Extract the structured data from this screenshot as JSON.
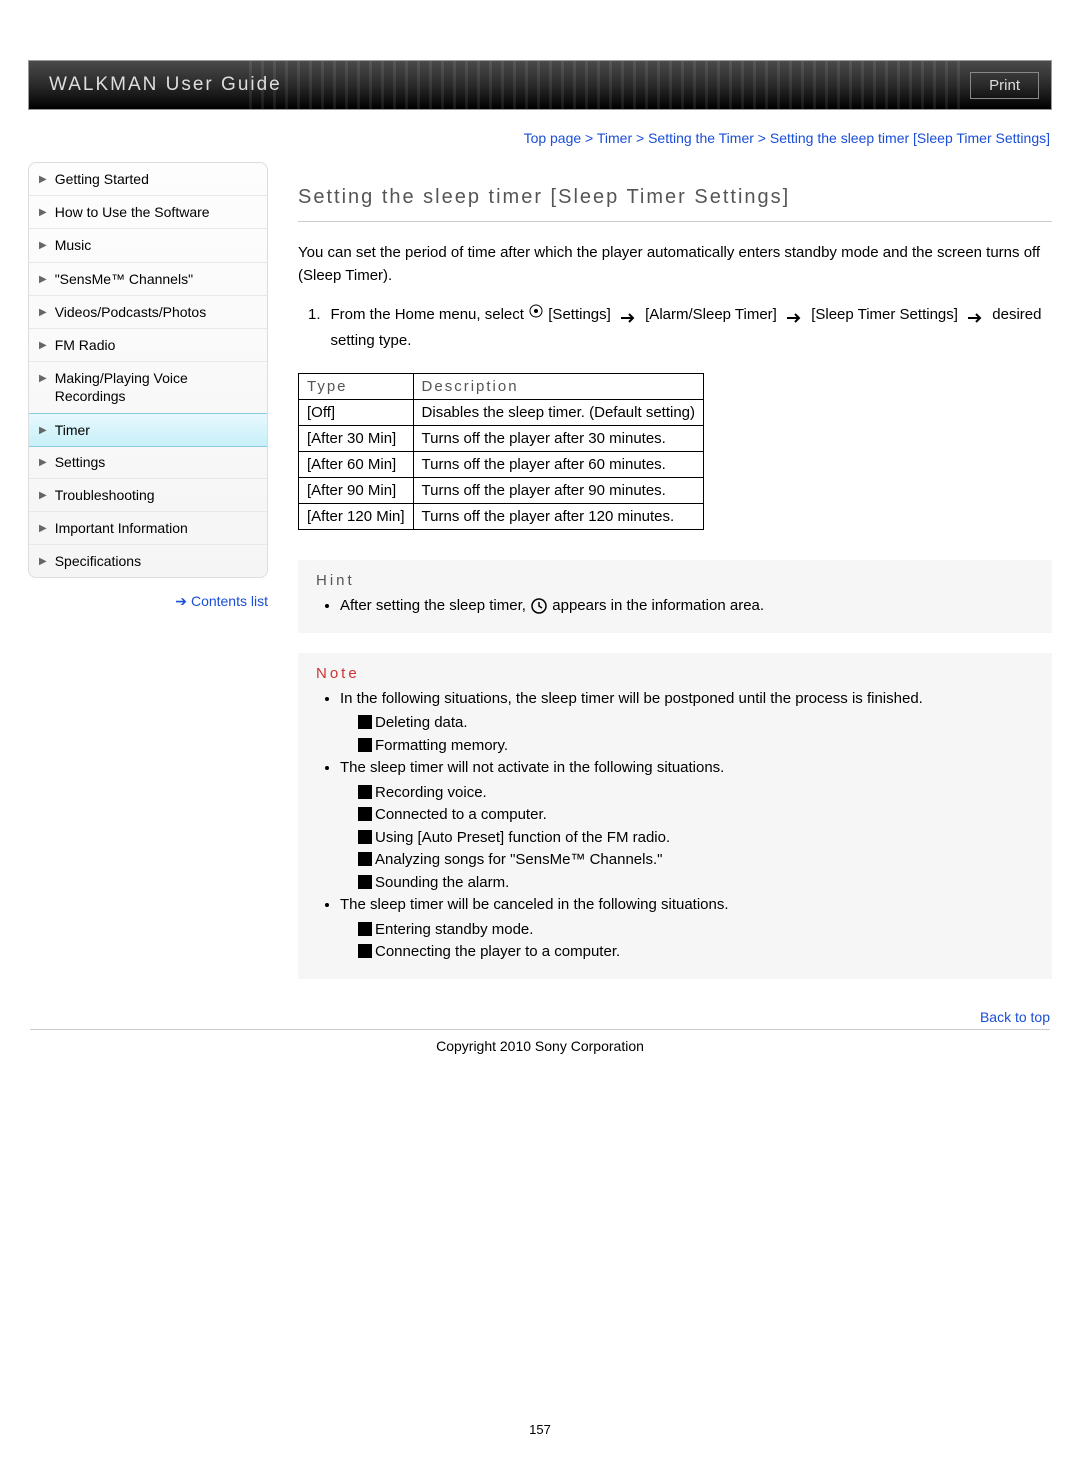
{
  "header": {
    "title": "WALKMAN User Guide",
    "print": "Print"
  },
  "breadcrumb": {
    "items": [
      "Top page",
      "Timer",
      "Setting the Timer",
      "Setting the sleep timer [Sleep Timer Settings]"
    ],
    "text": "Top page > Timer > Setting the Timer > Setting the sleep timer [Sleep Timer Settings]"
  },
  "sidebar": {
    "items": [
      {
        "label": "Getting Started",
        "active": false
      },
      {
        "label": "How to Use the Software",
        "active": false
      },
      {
        "label": "Music",
        "active": false
      },
      {
        "label": "\"SensMe™ Channels\"",
        "active": false
      },
      {
        "label": "Videos/Podcasts/Photos",
        "active": false
      },
      {
        "label": "FM Radio",
        "active": false
      },
      {
        "label": "Making/Playing Voice Recordings",
        "active": false
      },
      {
        "label": "Timer",
        "active": true
      },
      {
        "label": "Settings",
        "active": false
      },
      {
        "label": "Troubleshooting",
        "active": false
      },
      {
        "label": "Important Information",
        "active": false
      },
      {
        "label": "Specifications",
        "active": false
      }
    ],
    "contents_list": "Contents list"
  },
  "main": {
    "title": "Setting the sleep timer [Sleep Timer Settings]",
    "intro": "You can set the period of time after which the player automatically enters standby mode and the screen turns off (Sleep Timer).",
    "step_number": "1.",
    "step_p1": "From the Home menu, select ",
    "step_p2": " [Settings] ",
    "step_p3": " [Alarm/Sleep Timer] ",
    "step_p4": " [Sleep Timer Settings] ",
    "step_p5": " desired setting type.",
    "table": {
      "headers": [
        "Type",
        "Description"
      ],
      "rows": [
        [
          "[Off]",
          "Disables the sleep timer. (Default setting)"
        ],
        [
          "[After 30 Min]",
          "Turns off the player after 30 minutes."
        ],
        [
          "[After 60 Min]",
          "Turns off the player after 60 minutes."
        ],
        [
          "[After 90 Min]",
          "Turns off the player after 90 minutes."
        ],
        [
          "[After 120 Min]",
          "Turns off the player after 120 minutes."
        ]
      ]
    },
    "hint": {
      "title": "Hint",
      "item_pre": "After setting the sleep timer, ",
      "item_post": " appears in the information area."
    },
    "note": {
      "title": "Note",
      "bullets": [
        {
          "text": "In the following situations, the sleep timer will be postponed until the process is finished.",
          "sub": [
            "Deleting data.",
            "Formatting memory."
          ]
        },
        {
          "text": "The sleep timer will not activate in the following situations.",
          "sub": [
            "Recording voice.",
            "Connected to a computer.",
            "Using [Auto Preset] function of the FM radio.",
            "Analyzing songs for \"SensMe™ Channels.\"",
            "Sounding the alarm."
          ]
        },
        {
          "text": "The sleep timer will be canceled in the following situations.",
          "sub": [
            "Entering standby mode.",
            "Connecting the player to a computer."
          ]
        }
      ]
    }
  },
  "footer": {
    "back_to_top": "Back to top",
    "copyright": "Copyright 2010 Sony Corporation",
    "page_number": "157"
  }
}
